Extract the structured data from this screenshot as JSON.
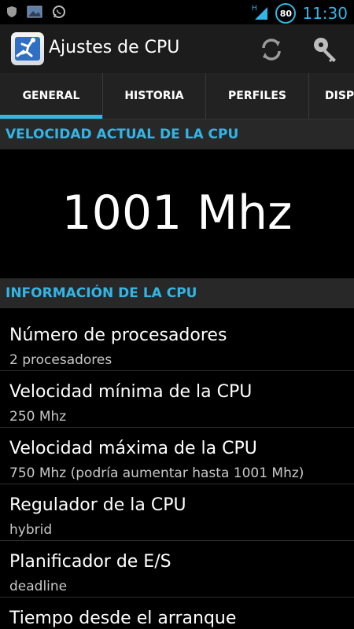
{
  "status_bar": {
    "time": "11:30",
    "battery_level": "80",
    "network_type": "H",
    "icons": [
      "shield-icon",
      "image-notification-icon",
      "whatsapp-icon",
      "signal-icon"
    ]
  },
  "action_bar": {
    "title": "Ajustes de CPU",
    "actions": [
      "refresh-icon",
      "key-icon"
    ]
  },
  "tabs": [
    {
      "label": "GENERAL",
      "active": true
    },
    {
      "label": "HISTORIA",
      "active": false
    },
    {
      "label": "PERFILES",
      "active": false
    },
    {
      "label": "DISPO",
      "active": false
    }
  ],
  "current_speed": {
    "header": "VELOCIDAD ACTUAL DE LA CPU",
    "value": "1001 Mhz"
  },
  "cpu_info": {
    "header": "INFORMACIÓN DE LA CPU",
    "items": [
      {
        "title": "Número de procesadores",
        "value": "2 procesadores"
      },
      {
        "title": "Velocidad mínima de la CPU",
        "value": "250 Mhz"
      },
      {
        "title": "Velocidad máxima de la CPU",
        "value": "750 Mhz (podría aumentar hasta 1001 Mhz)"
      },
      {
        "title": "Regulador de la CPU",
        "value": "hybrid"
      },
      {
        "title": "Planificador de E/S",
        "value": "deadline"
      },
      {
        "title": "Tiempo desde el arranque",
        "value": ""
      }
    ]
  },
  "colors": {
    "accent": "#33b5e5",
    "background": "#000000",
    "section_header_bg": "#282828",
    "action_bar_bg": "#1c1c1c"
  }
}
